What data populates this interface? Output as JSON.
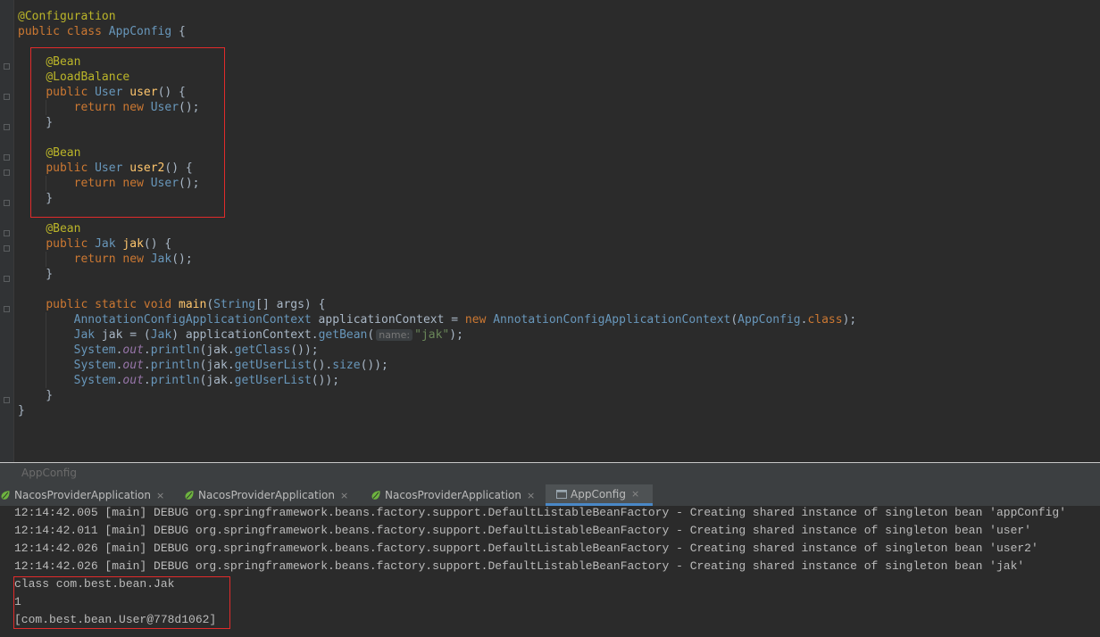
{
  "editor": {
    "code_lines": [
      {
        "tokens": [
          {
            "c": "ann",
            "t": "@Configuration"
          }
        ]
      },
      {
        "tokens": [
          {
            "c": "kw",
            "t": "public class "
          },
          {
            "c": "cls",
            "t": "AppConfig"
          },
          {
            "c": "txt",
            "t": " {"
          }
        ]
      },
      {
        "tokens": []
      },
      {
        "tokens": [
          {
            "c": "txt",
            "t": "    "
          },
          {
            "c": "ann",
            "t": "@Bean"
          }
        ]
      },
      {
        "tokens": [
          {
            "c": "txt",
            "t": "    "
          },
          {
            "c": "ann",
            "t": "@LoadBalance"
          }
        ]
      },
      {
        "tokens": [
          {
            "c": "txt",
            "t": "    "
          },
          {
            "c": "kw",
            "t": "public "
          },
          {
            "c": "cls",
            "t": "User"
          },
          {
            "c": "txt",
            "t": " "
          },
          {
            "c": "fn",
            "t": "user"
          },
          {
            "c": "txt",
            "t": "() {"
          }
        ]
      },
      {
        "tokens": [
          {
            "c": "txt",
            "t": "        "
          },
          {
            "c": "kw",
            "t": "return new "
          },
          {
            "c": "cls",
            "t": "User"
          },
          {
            "c": "txt",
            "t": "();"
          }
        ]
      },
      {
        "tokens": [
          {
            "c": "txt",
            "t": "    }"
          }
        ]
      },
      {
        "tokens": []
      },
      {
        "tokens": [
          {
            "c": "txt",
            "t": "    "
          },
          {
            "c": "ann",
            "t": "@Bean"
          }
        ]
      },
      {
        "tokens": [
          {
            "c": "txt",
            "t": "    "
          },
          {
            "c": "kw",
            "t": "public "
          },
          {
            "c": "cls",
            "t": "User"
          },
          {
            "c": "txt",
            "t": " "
          },
          {
            "c": "fn",
            "t": "user2"
          },
          {
            "c": "txt",
            "t": "() {"
          }
        ]
      },
      {
        "tokens": [
          {
            "c": "txt",
            "t": "        "
          },
          {
            "c": "kw",
            "t": "return new "
          },
          {
            "c": "cls",
            "t": "User"
          },
          {
            "c": "txt",
            "t": "();"
          }
        ]
      },
      {
        "tokens": [
          {
            "c": "txt",
            "t": "    }"
          }
        ]
      },
      {
        "tokens": []
      },
      {
        "tokens": [
          {
            "c": "txt",
            "t": "    "
          },
          {
            "c": "ann",
            "t": "@Bean"
          }
        ]
      },
      {
        "tokens": [
          {
            "c": "txt",
            "t": "    "
          },
          {
            "c": "kw",
            "t": "public "
          },
          {
            "c": "cls",
            "t": "Jak"
          },
          {
            "c": "txt",
            "t": " "
          },
          {
            "c": "fn",
            "t": "jak"
          },
          {
            "c": "txt",
            "t": "() {"
          }
        ]
      },
      {
        "tokens": [
          {
            "c": "txt",
            "t": "        "
          },
          {
            "c": "kw",
            "t": "return new "
          },
          {
            "c": "cls",
            "t": "Jak"
          },
          {
            "c": "txt",
            "t": "();"
          }
        ]
      },
      {
        "tokens": [
          {
            "c": "txt",
            "t": "    }"
          }
        ]
      },
      {
        "tokens": []
      },
      {
        "tokens": [
          {
            "c": "txt",
            "t": "    "
          },
          {
            "c": "kw",
            "t": "public static void "
          },
          {
            "c": "fn",
            "t": "main"
          },
          {
            "c": "txt",
            "t": "("
          },
          {
            "c": "cls",
            "t": "String"
          },
          {
            "c": "txt",
            "t": "[] args) {"
          }
        ]
      },
      {
        "tokens": [
          {
            "c": "txt",
            "t": "        "
          },
          {
            "c": "cls",
            "t": "AnnotationConfigApplicationContext"
          },
          {
            "c": "txt",
            "t": " applicationContext = "
          },
          {
            "c": "kw",
            "t": "new "
          },
          {
            "c": "cls",
            "t": "AnnotationConfigApplicationContext"
          },
          {
            "c": "txt",
            "t": "("
          },
          {
            "c": "cls",
            "t": "AppConfig"
          },
          {
            "c": "txt",
            "t": "."
          },
          {
            "c": "kw",
            "t": "class"
          },
          {
            "c": "txt",
            "t": ");"
          }
        ]
      },
      {
        "tokens": [
          {
            "c": "txt",
            "t": "        "
          },
          {
            "c": "cls",
            "t": "Jak"
          },
          {
            "c": "txt",
            "t": " jak = ("
          },
          {
            "c": "cls",
            "t": "Jak"
          },
          {
            "c": "txt",
            "t": ") applicationContext."
          },
          {
            "c": "cls",
            "t": "getBean"
          },
          {
            "c": "txt",
            "t": "("
          },
          {
            "c": "hint",
            "t": "name:"
          },
          {
            "c": "str",
            "t": "\"jak\""
          },
          {
            "c": "txt",
            "t": ");"
          }
        ]
      },
      {
        "tokens": [
          {
            "c": "txt",
            "t": "        "
          },
          {
            "c": "cls",
            "t": "System"
          },
          {
            "c": "txt",
            "t": "."
          },
          {
            "c": "fld",
            "t": "out"
          },
          {
            "c": "txt",
            "t": "."
          },
          {
            "c": "cls",
            "t": "println"
          },
          {
            "c": "txt",
            "t": "(jak."
          },
          {
            "c": "cls",
            "t": "getClass"
          },
          {
            "c": "txt",
            "t": "());"
          }
        ]
      },
      {
        "tokens": [
          {
            "c": "txt",
            "t": "        "
          },
          {
            "c": "cls",
            "t": "System"
          },
          {
            "c": "txt",
            "t": "."
          },
          {
            "c": "fld",
            "t": "out"
          },
          {
            "c": "txt",
            "t": "."
          },
          {
            "c": "cls",
            "t": "println"
          },
          {
            "c": "txt",
            "t": "(jak."
          },
          {
            "c": "cls",
            "t": "getUserList"
          },
          {
            "c": "txt",
            "t": "()."
          },
          {
            "c": "cls",
            "t": "size"
          },
          {
            "c": "txt",
            "t": "());"
          }
        ]
      },
      {
        "tokens": [
          {
            "c": "txt",
            "t": "        "
          },
          {
            "c": "cls",
            "t": "System"
          },
          {
            "c": "txt",
            "t": "."
          },
          {
            "c": "fld",
            "t": "out"
          },
          {
            "c": "txt",
            "t": "."
          },
          {
            "c": "cls",
            "t": "println"
          },
          {
            "c": "txt",
            "t": "(jak."
          },
          {
            "c": "cls",
            "t": "getUserList"
          },
          {
            "c": "txt",
            "t": "());"
          }
        ]
      },
      {
        "tokens": [
          {
            "c": "txt",
            "t": "    }"
          }
        ]
      },
      {
        "tokens": [
          {
            "c": "txt",
            "t": "}"
          }
        ]
      }
    ]
  },
  "structure_bar": {
    "label": "AppConfig"
  },
  "run_tabs": [
    {
      "label": "NacosProviderApplication",
      "active": false,
      "icon": "spring-boot-icon"
    },
    {
      "label": "NacosProviderApplication",
      "active": false,
      "icon": "spring-boot-icon"
    },
    {
      "label": "NacosProviderApplication",
      "active": false,
      "icon": "spring-boot-icon"
    },
    {
      "label": "AppConfig",
      "active": true,
      "icon": "application-icon"
    }
  ],
  "tab_close_glyph": "×",
  "console": {
    "lines": [
      "12:14:42.005 [main] DEBUG org.springframework.beans.factory.support.DefaultListableBeanFactory - Creating shared instance of singleton bean 'appConfig'",
      "12:14:42.011 [main] DEBUG org.springframework.beans.factory.support.DefaultListableBeanFactory - Creating shared instance of singleton bean 'user'",
      "12:14:42.026 [main] DEBUG org.springframework.beans.factory.support.DefaultListableBeanFactory - Creating shared instance of singleton bean 'user2'",
      "12:14:42.026 [main] DEBUG org.springframework.beans.factory.support.DefaultListableBeanFactory - Creating shared instance of singleton bean 'jak'",
      "class com.best.bean.Jak",
      "1",
      "[com.best.bean.User@778d1062]"
    ]
  },
  "colors": {
    "highlight": "#e12b2b",
    "active_tab_underline": "#4a88c7",
    "spring_icon": "#6db33f"
  }
}
